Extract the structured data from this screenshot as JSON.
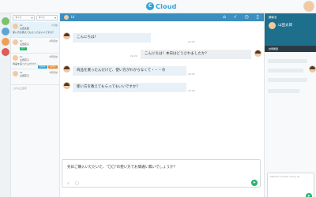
{
  "app": {
    "logo_text": "Cloud",
    "logo_mark": "C"
  },
  "filters": {
    "sel1": "すべて",
    "sel2": "すべて"
  },
  "chat_list": [
    {
      "line1": "LV",
      "line2": "山田太郎",
      "line3": "使い方を教えてもらってもいいですか？",
      "time": "2分前"
    },
    {
      "line1": "LV",
      "line2": "山田花子",
      "line3": "",
      "time": "2時間前",
      "tag": "完了",
      "tag_color": "#25b36b"
    },
    {
      "line1": "LV",
      "line2": "山田花子",
      "line3": "商品を買ったんだけど…",
      "time": "3時間前",
      "tags": [
        {
          "text": "対応中",
          "color": "#2fa4d6"
        },
        {
          "text": "未対応",
          "color": "#f08a24"
        }
      ]
    },
    {
      "line1": "LV",
      "line2": "山田花子",
      "line3": "",
      "time": "3時間前"
    }
  ],
  "chat_list_more": "これ以上表示",
  "chat_header": {
    "name": "LV"
  },
  "messages": [
    {
      "dir": "in",
      "text": "こんにちは！",
      "time": "22:23"
    },
    {
      "dir": "out",
      "text": "こんにちは！本日はどうされましたか？",
      "time": "22:24"
    },
    {
      "dir": "in",
      "text": "商品を買ったんだけど、使い方がわからなくて・・・😞",
      "time": "22:25"
    },
    {
      "dir": "in",
      "text": "使い方を教えてもらってもいいですか？",
      "time": "22:26"
    }
  ],
  "composer": {
    "text": "先日ご購入いただいた、\"〇〇\"の使い方でお間違い無いでしょうか？"
  },
  "right_panel": {
    "label": "顧客名",
    "customer_name": "山田太郎",
    "band_text": "訪問履歴",
    "note_placeholder": "Mention people using '@'"
  },
  "colors": {
    "primary": "#3a8ec0",
    "dark": "#1e6f8c",
    "accent": "#25b36b",
    "bubble_in": "#e8f1f7",
    "bubble_out": "#eceff1"
  }
}
